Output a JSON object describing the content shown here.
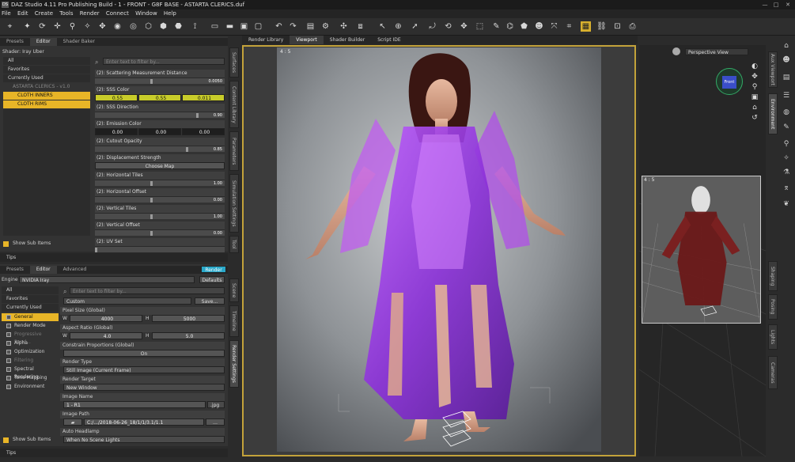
{
  "window": {
    "title": "DAZ Studio 4.11 Pro Publishing Build - 1 - FRONT - G8F BASE - ASTARTA CLERICS.duf",
    "min": "—",
    "max": "□",
    "close": "✕"
  },
  "menu": [
    "File",
    "Edit",
    "Create",
    "Tools",
    "Render",
    "Connect",
    "Window",
    "Help"
  ],
  "center_tabs": [
    "Render Library",
    "Viewport",
    "Shader Builder",
    "Script IDE"
  ],
  "surfaces": {
    "tabs": [
      "Presets",
      "Editor",
      "Shader Baker"
    ],
    "shader": "Shader: Iray Uber",
    "filters": [
      "All",
      "Favorites",
      "Currently Used"
    ],
    "tree_root": "ASTARTA CLERICS - v1.0",
    "tree_items": [
      "CLOTH INNERS",
      "CLOTH RIMS"
    ],
    "filter_placeholder": "Enter text to filter by...",
    "props": [
      {
        "label": "(2): Scattering Measurement Distance",
        "val": "0.0050"
      },
      {
        "label": "(2): SSS Color",
        "c1": "0.55",
        "c2": "0.55",
        "c3": "0.011"
      },
      {
        "label": "(2): SSS Direction",
        "val": "0.90"
      },
      {
        "label": "(2): Emission Color",
        "c1": "0.00",
        "c2": "0.00",
        "c3": "0.00"
      },
      {
        "label": "(2): Cutout Opacity",
        "val": "0.85"
      },
      {
        "label": "(2): Displacement Strength",
        "button": "Choose Map"
      },
      {
        "label": "(2): Horizontal Tiles",
        "val": "1.00"
      },
      {
        "label": "(2): Horizontal Offset",
        "val": "0.00"
      },
      {
        "label": "(2): Vertical Tiles",
        "val": "1.00"
      },
      {
        "label": "(2): Vertical Offset",
        "val": "0.00"
      },
      {
        "label": "(2): UV Set",
        "val": ""
      }
    ],
    "show_sub": "Show Sub Items",
    "tips": "Tips"
  },
  "left_side_tabs": [
    "Surfaces",
    "Content Library",
    "Parameters",
    "Simulation Settings",
    "Tool"
  ],
  "left_side_tabs2": [
    "Scene",
    "Timeline",
    "Render Settings"
  ],
  "render": {
    "tabs": [
      "Presets",
      "Editor",
      "Advanced"
    ],
    "render_btn": "Render",
    "engine_label": "Engine",
    "engine": "NVIDIA Iray",
    "defaults": "Defaults",
    "filters": [
      "All",
      "Favorites",
      "Currently Used"
    ],
    "groups": [
      "General",
      "Render Mode",
      "Progressive Rend...",
      "Alpha",
      "Optimization",
      "Filtering",
      "Spectral Rendering",
      "Tone Mapping",
      "Environment"
    ],
    "filter_placeholder": "Enter text to filter by...",
    "preset": "Custom",
    "save": "Save...",
    "pixel_size": "Pixel Size (Global)",
    "w": "W",
    "h": "H",
    "w_val": "4000",
    "h_val": "5000",
    "aspect": "Aspect Ratio (Global)",
    "aw": "4.0",
    "ah": "5.0",
    "constrain": "Constrain Proportions (Global)",
    "on": "On",
    "render_type": "Render Type",
    "render_type_val": "Still Image (Current Frame)",
    "render_target": "Render Target",
    "render_target_val": "New Window",
    "image_name": "Image Name",
    "image_name_val": "1 - R1",
    "ext": ".jpg",
    "image_path": "Image Path",
    "image_path_val": "C:/.../2018-06-26_18/1/1/3.1/1.1",
    "headlamp": "Auto Headlamp",
    "headlamp_val": "When No Scene Lights",
    "show_sub": "Show Sub Items",
    "tips": "Tips"
  },
  "viewport": {
    "ratio": "4 : 5",
    "camera": "Perspective View",
    "nav_cube": "Front"
  },
  "aux": {
    "ratio": "4 : 5"
  },
  "right_tabs": [
    "Aux Viewport",
    "Environment",
    "Shaping",
    "Posing",
    "Lights",
    "Cameras"
  ]
}
